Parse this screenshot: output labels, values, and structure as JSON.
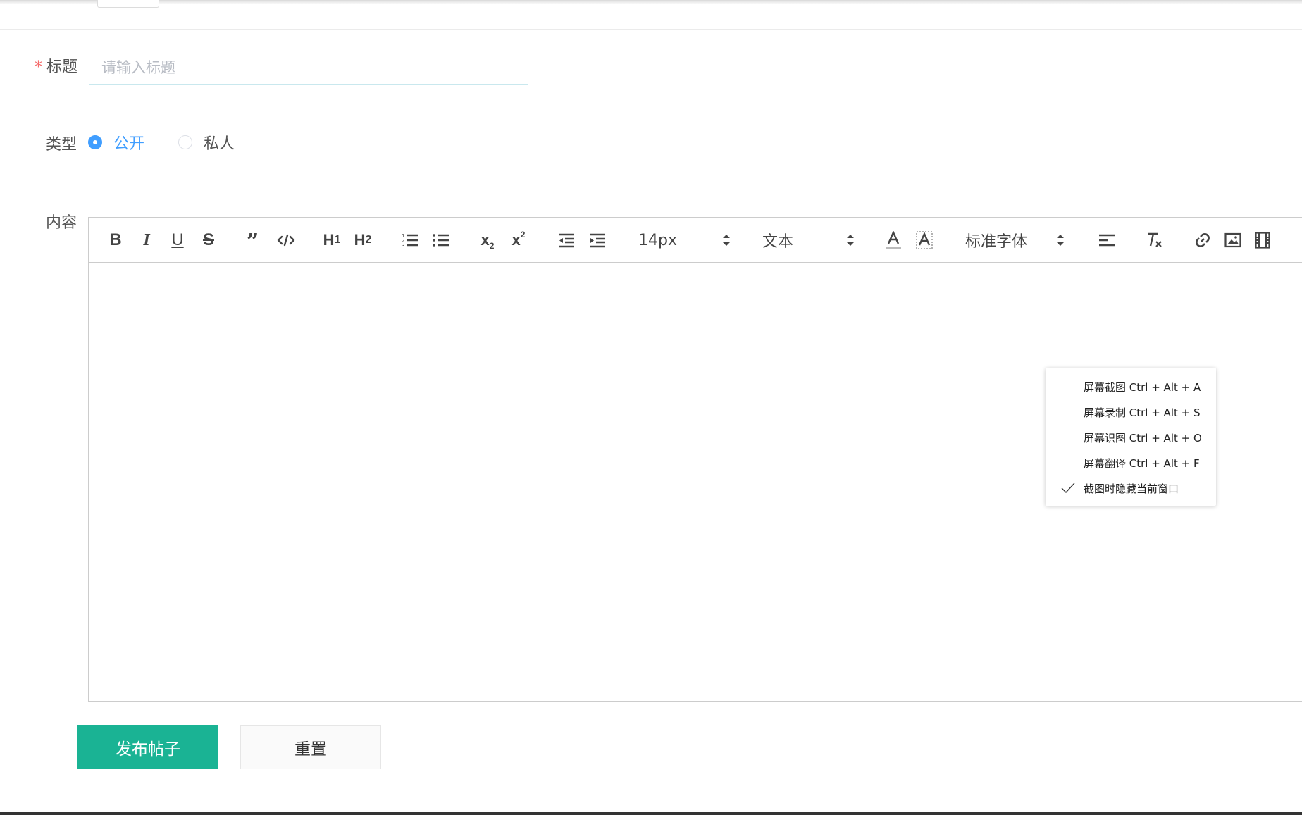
{
  "form": {
    "title_label": "标题",
    "title_required_mark": "*",
    "title_placeholder": "请输入标题",
    "title_value": "",
    "type_label": "类型",
    "type_options": [
      "公开",
      "私人"
    ],
    "type_selected": "公开",
    "content_label": "内容"
  },
  "toolbar": {
    "font_size": "14px",
    "header_picker": "文本",
    "font_family_picker": "标准字体"
  },
  "context_menu": {
    "items": [
      {
        "label": "屏幕截图 Ctrl + Alt + A",
        "checked": false
      },
      {
        "label": "屏幕录制 Ctrl + Alt + S",
        "checked": false
      },
      {
        "label": "屏幕识图 Ctrl + Alt + O",
        "checked": false
      },
      {
        "label": "屏幕翻译 Ctrl + Alt + F",
        "checked": false
      },
      {
        "label": "截图时隐藏当前窗口",
        "checked": true
      }
    ]
  },
  "actions": {
    "submit_label": "发布帖子",
    "reset_label": "重置"
  },
  "colors": {
    "primary_button": "#1ab394",
    "radio_active": "#409eff",
    "required_star": "#f56c6c"
  },
  "icons": {
    "toolbar": [
      "bold-icon",
      "italic-icon",
      "underline-icon",
      "strike-icon",
      "blockquote-icon",
      "code-block-icon",
      "h1-icon",
      "h2-icon",
      "ordered-list-icon",
      "bullet-list-icon",
      "subscript-icon",
      "superscript-icon",
      "outdent-icon",
      "indent-icon",
      "font-color-icon",
      "background-color-icon",
      "align-icon",
      "clear-format-icon",
      "link-icon",
      "image-icon",
      "video-icon"
    ]
  }
}
